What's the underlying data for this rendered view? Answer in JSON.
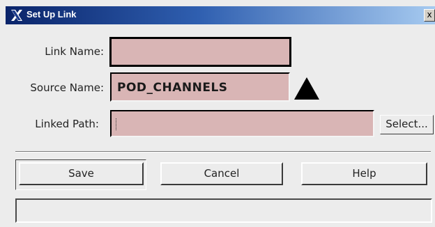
{
  "window": {
    "title": "Set Up Link",
    "close_glyph": "x",
    "icon": "x-logo-icon"
  },
  "form": {
    "link_name_label": "Link Name:",
    "link_name_value": "",
    "source_name_label": "Source Name:",
    "source_name_value": "POD_CHANNELS",
    "source_menu_icon": "triangle-up-icon",
    "linked_path_label": "Linked Path:",
    "linked_path_value": "",
    "select_label": "Select..."
  },
  "actions": {
    "save_label": "Save",
    "cancel_label": "Cancel",
    "help_label": "Help"
  },
  "status": {
    "message": ""
  },
  "colors": {
    "field_bg": "#d9b5b5",
    "titlebar_start": "#0a246a",
    "titlebar_end": "#a6caf0",
    "dialog_bg": "#ececec"
  }
}
